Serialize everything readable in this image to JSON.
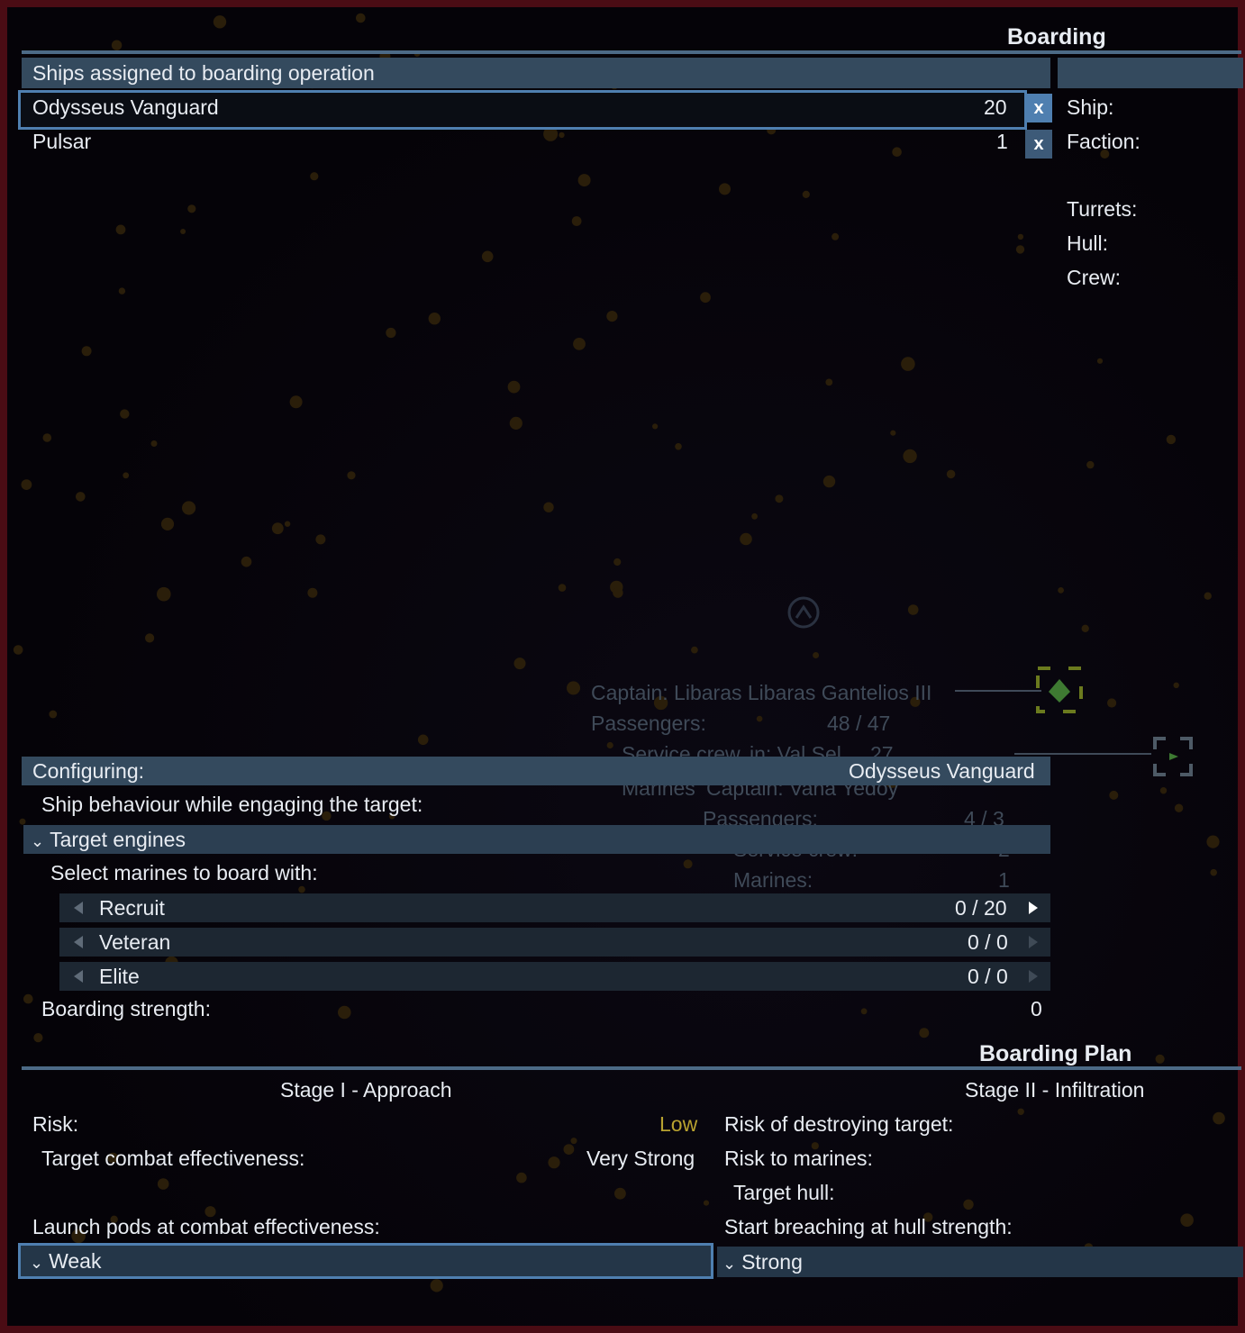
{
  "window": {
    "title": "Boarding"
  },
  "assigned": {
    "header": "Ships assigned to boarding operation",
    "ships": [
      {
        "name": "Odysseus Vanguard",
        "count": "20",
        "remove": "x"
      },
      {
        "name": "Pulsar",
        "count": "1",
        "remove": "x"
      }
    ]
  },
  "target_info": {
    "ship_label": "Ship:",
    "faction_label": "Faction:",
    "turrets_label": "Turrets:",
    "hull_label": "Hull:",
    "crew_label": "Crew:"
  },
  "map_overlay": {
    "captain1": "Captain: Libaras Libaras Gantelios III",
    "passengers1_label": "Passengers:",
    "passengers1_value": "48 / 47",
    "service_crew1": "Service crew",
    "captain2_frag": "in: Val Sel",
    "value_frag": "27",
    "marines1": "Marines",
    "captain2": "Captain: Vana Yedoy",
    "passengers2_label": "Passengers:",
    "passengers2_value": "4 / 3",
    "service_crew2_label": "Service crew:",
    "service_crew2_value": "2",
    "marines2_label": "Marines:",
    "marines2_value": "1"
  },
  "configuring": {
    "label": "Configuring:",
    "ship": "Odysseus Vanguard",
    "behaviour_label": "Ship behaviour while engaging the target:",
    "behaviour_value": "Target engines",
    "marines_label": "Select marines to board with:",
    "marines": [
      {
        "name": "Recruit",
        "value": "0 / 20"
      },
      {
        "name": "Veteran",
        "value": "0 / 0"
      },
      {
        "name": "Elite",
        "value": "0 / 0"
      }
    ],
    "strength_label": "Boarding strength:",
    "strength_value": "0"
  },
  "plan": {
    "title": "Boarding Plan",
    "stage1": {
      "title": "Stage I - Approach",
      "risk_label": "Risk:",
      "risk_value": "Low",
      "combat_label": "Target combat effectiveness:",
      "combat_value": "Very Strong",
      "launch_label": "Launch pods at combat effectiveness:",
      "launch_value": "Weak"
    },
    "stage2": {
      "title": "Stage II - Infiltration",
      "destroy_label": "Risk of destroying target:",
      "marines_risk_label": "Risk to marines:",
      "hull_label": "Target hull:",
      "breach_label": "Start breaching at hull strength:",
      "breach_value": "Strong"
    }
  },
  "colors": {
    "accent": "#4f7fb0",
    "risk_low": "#b8a230",
    "frame": "#4a0c14"
  }
}
